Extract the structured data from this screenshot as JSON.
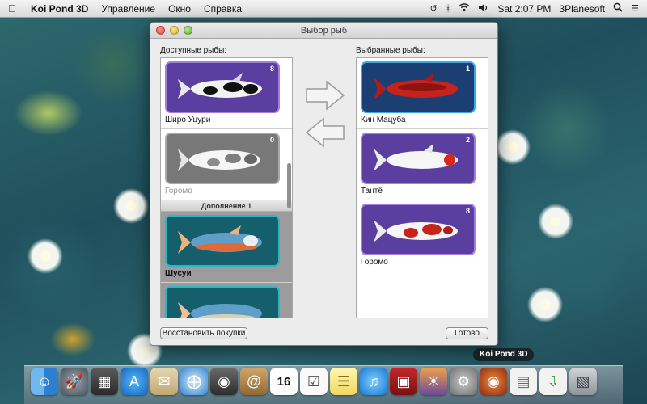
{
  "menubar": {
    "app_name": "Koi Pond 3D",
    "items": [
      "Управление",
      "Окно",
      "Справка"
    ],
    "clock": "Sat 2:07 PM",
    "user": "3Planesoft"
  },
  "window": {
    "title": "Выбор рыб",
    "available_label": "Доступные рыбы:",
    "selected_label": "Выбранные рыбы:",
    "available_fish": [
      {
        "name": "Широ Уцури",
        "count": "8",
        "dimmed": false
      },
      {
        "name": "Горомо",
        "count": "0",
        "dimmed": true
      }
    ],
    "expansion_header": "Дополнение 1",
    "expansion_fish": [
      {
        "name": "Шусуи"
      }
    ],
    "selected_fish": [
      {
        "name": "Кин Мацуба",
        "count": "1"
      },
      {
        "name": "Тантё",
        "count": "2"
      },
      {
        "name": "Горомо",
        "count": "8"
      }
    ],
    "restore_button": "Восстановить покупки",
    "done_button": "Готово"
  },
  "dock": {
    "tooltip": "Koi Pond 3D",
    "icons": [
      "finder-icon",
      "launchpad-icon",
      "dashboard-icon",
      "app-store-icon",
      "mail-stamp-icon",
      "safari-icon",
      "facetime-icon",
      "contacts-icon",
      "calendar-icon",
      "reminders-icon",
      "notes-icon",
      "itunes-icon",
      "photo-booth-icon",
      "iphoto-icon",
      "system-preferences-icon",
      "koi-pond-icon",
      "document-icon",
      "installer-icon",
      "trash-icon"
    ],
    "calendar_day": "16"
  },
  "colors": {
    "card_purple": "#5a3fa1",
    "card_teal": "#155f6c",
    "card_blue": "#1b3f73"
  }
}
